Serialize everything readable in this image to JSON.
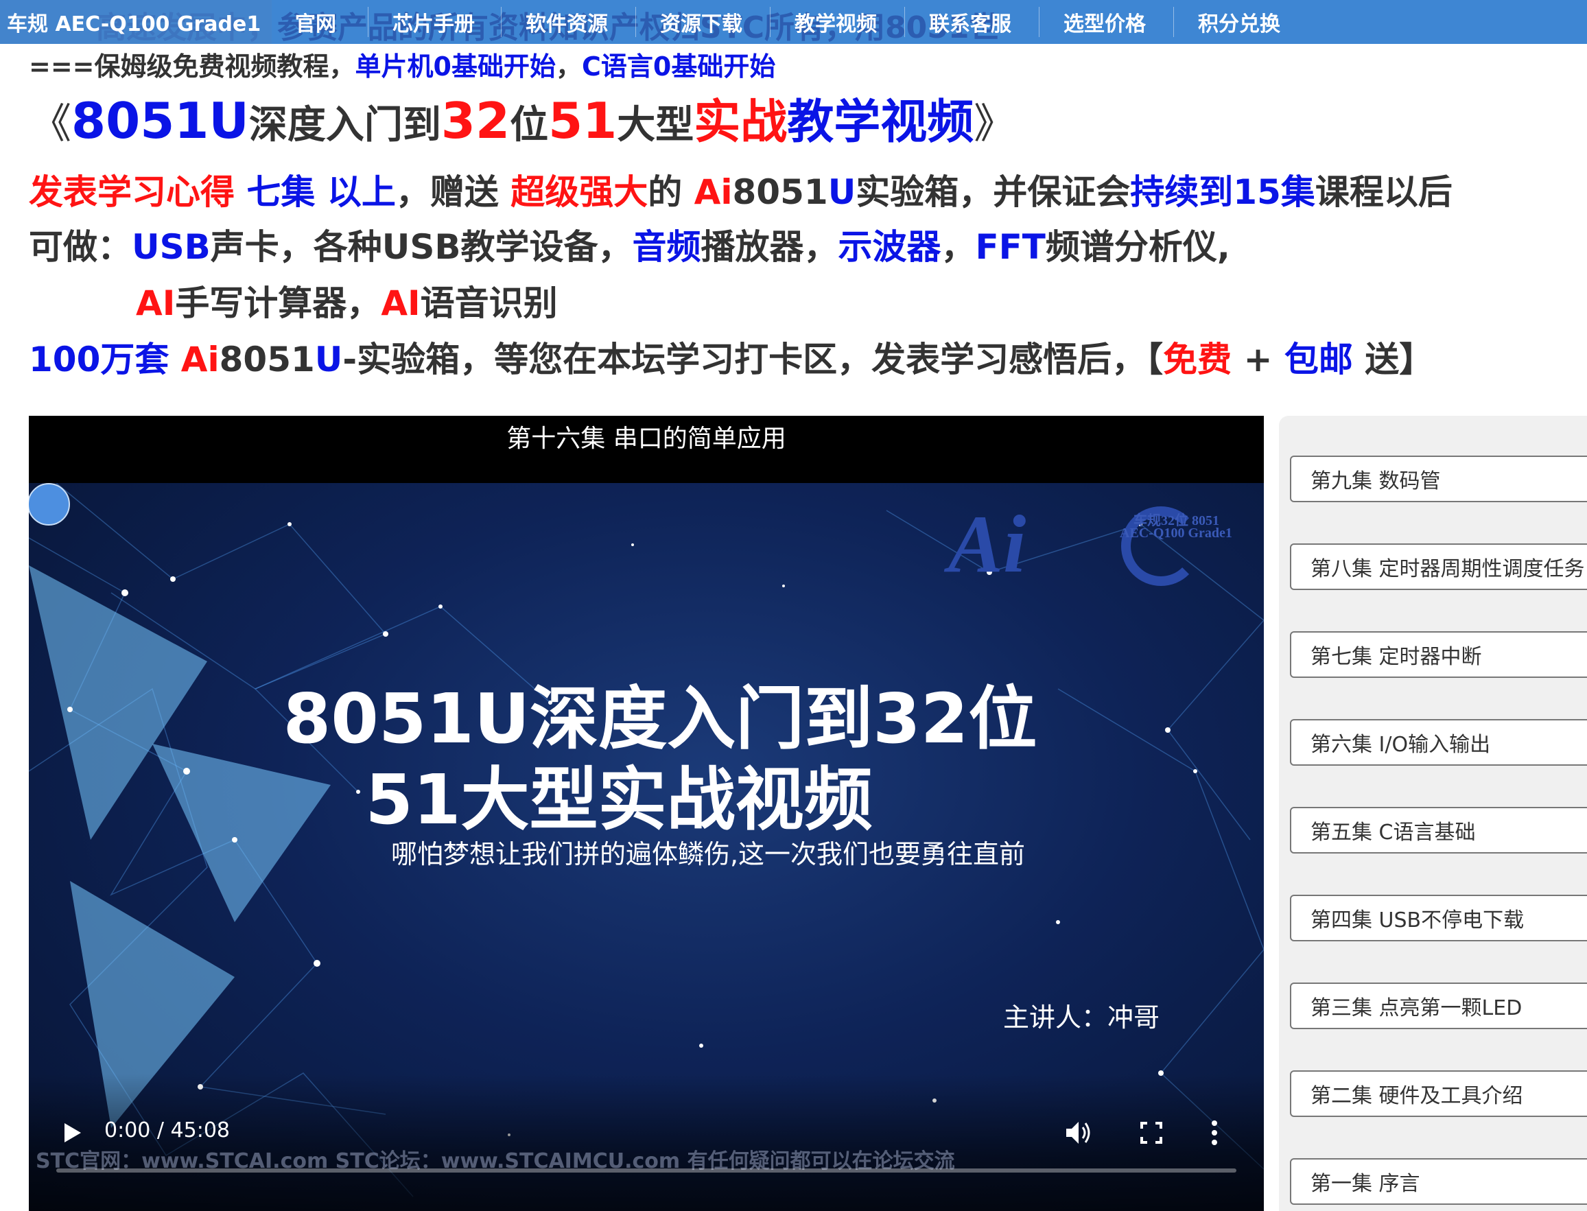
{
  "topbar": {
    "brand": "车规 AEC-Q100 Grade1",
    "ticker": "高速发展中，参赛产品的所有资料知识产权归STC所有，用8051世",
    "nav": [
      "官网",
      "芯片手册",
      "软件资源",
      "资源下载",
      "教学视频",
      "联系客服",
      "选型价格",
      "积分兑换"
    ]
  },
  "intro": {
    "prefix": "===保姆级免费视频教程，",
    "part1": "单片机0基础开始",
    "sep": "，",
    "part2": "C语言0基础开始"
  },
  "headline": {
    "open": "《",
    "a": "8051U",
    "b": "深度入门到",
    "c": "32",
    "d": "位",
    "e": "51",
    "f": "大型",
    "g": "实战",
    "h": "教学视频",
    "close": "》"
  },
  "promo": {
    "l1a": "发表学习心得",
    "l1b": " 七集 以上",
    "l1c": "，赠送 ",
    "l1d": "超级强大",
    "l1e": "的 ",
    "l1f": "Ai",
    "l1g": "8051",
    "l1h": "U",
    "l1i": "实验箱，并保证会",
    "l1j": "持续到15集",
    "l1k": "课程以后",
    "l2a": "可做：",
    "l2b": "USB",
    "l2c": "声卡",
    "l2d": "，各种USB教学设备，",
    "l2e": "音频",
    "l2f": "播放器，",
    "l2g": "示波器",
    "l2h": "，",
    "l2i": "FFT",
    "l2j": "频谱分析仪,",
    "l3a": "AI",
    "l3b": "手写计算器，",
    "l3c": "AI",
    "l3d": "语音识别",
    "l4a": "100万套 ",
    "l4b": "Ai",
    "l4c": "8051",
    "l4d": "U",
    "l4e": "-实验箱，等您在本坛学习打卡区，发表学习感悟后，【",
    "l4f": "免费",
    "l4g": " + ",
    "l4h": "包邮",
    "l4i": " 送】"
  },
  "video": {
    "episode_title": "第十六集 串口的简单应用",
    "logo_text": "Ai",
    "logo_sub1": "车规32位 8051",
    "logo_sub2": "AEC-Q100 Grade1",
    "hero1": "8051U深度入门到32位",
    "hero2": "51大型实战视频",
    "slogan": "哪怕梦想让我们拼的遍体鳞伤,这一次我们也要勇往直前",
    "lecturer": "主讲人：冲哥",
    "footer": "STC官网：www.STCAI.com     STC论坛：www.STCAIMCU.com     有任何疑问都可以在论坛交流",
    "time": "0:00 / 45:08",
    "progress": 0
  },
  "playlist": [
    "第九集 数码管",
    "第八集 定时器周期性调度任务",
    "第七集 定时器中断",
    "第六集 I/O输入输出",
    "第五集 C语言基础",
    "第四集 USB不停电下载",
    "第三集 点亮第一颗LED",
    "第二集 硬件及工具介绍",
    "第一集 序言"
  ],
  "icons": {
    "play": "play-icon",
    "volume": "volume-icon",
    "fullscreen": "fullscreen-icon",
    "more": "more-options-icon"
  },
  "colors": {
    "nav_bg": "#3e86d3",
    "accent_blue": "#0a14e6",
    "accent_red": "#ff1414"
  }
}
